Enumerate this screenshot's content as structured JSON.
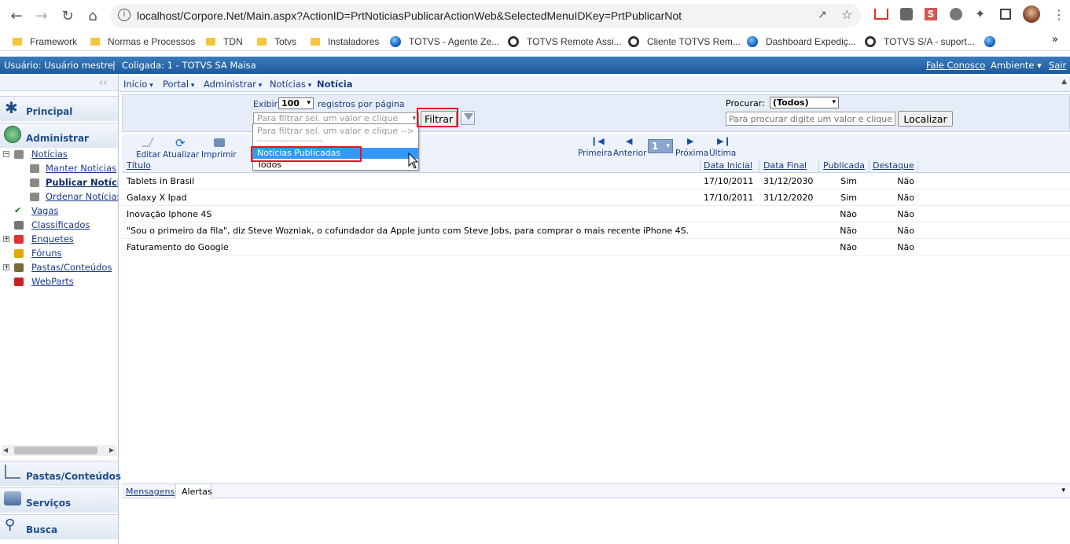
{
  "browser": {
    "url": "localhost/Corpore.Net/Main.aspx?ActionID=PrtNoticiasPublicarActionWeb&SelectedMenuIDKey=PrtPublicarNot",
    "bookmarks": [
      {
        "label": "Framework",
        "icon": "folder"
      },
      {
        "label": "Normas e Processos",
        "icon": "folder"
      },
      {
        "label": "TDN",
        "icon": "folder"
      },
      {
        "label": "Totvs",
        "icon": "folder"
      },
      {
        "label": "Instaladores",
        "icon": "folder"
      },
      {
        "label": "TOTVS - Agente Ze...",
        "icon": "globe"
      },
      {
        "label": "TOTVS Remote Assi...",
        "icon": "totvs"
      },
      {
        "label": "Cliente TOTVS Rem...",
        "icon": "totvs"
      },
      {
        "label": "Dashboard Expediç...",
        "icon": "globe"
      },
      {
        "label": "TOTVS S/A - suport...",
        "icon": "totvs"
      }
    ]
  },
  "topbar": {
    "user": "Usuário: Usuário mestre",
    "separator": "|",
    "coligada": "Coligada: 1 - TOTVS SA Maisa",
    "contact": "Fale Conosco",
    "ambiente": "Ambiente",
    "sair": "Sair"
  },
  "breadcrumb": {
    "items": [
      "Início",
      "Portal",
      "Administrar",
      "Notícias"
    ],
    "current": "Notícia"
  },
  "sidebar": {
    "collapse": "‹‹",
    "principal": "Principal",
    "administrar": "Administrar",
    "tree": [
      {
        "label": "Notícias",
        "level": 1
      },
      {
        "label": "Manter Notícias",
        "level": 2
      },
      {
        "label": "Publicar Notícia",
        "level": 2,
        "bold": true
      },
      {
        "label": "Ordenar Notícias",
        "level": 2
      },
      {
        "label": "Vagas",
        "level": 1
      },
      {
        "label": "Classificados",
        "level": 1
      },
      {
        "label": "Enquetes",
        "level": 1
      },
      {
        "label": "Fóruns",
        "level": 1
      },
      {
        "label": "Pastas/Conteúdos",
        "level": 1
      },
      {
        "label": "WebParts",
        "level": 1
      }
    ],
    "pastas": "Pastas/Conteúdos",
    "servicos": "Serviços",
    "busca": "Busca"
  },
  "filterpanel": {
    "exibir": "Exibir",
    "page_size": "100",
    "registros": "registros por página",
    "filter_placeholder": "Para filtrar sel. um valor e clique",
    "filtrar": "Filtrar",
    "procurar": "Procurar:",
    "procurar_value": "(Todos)",
    "search_placeholder": "Para procurar digite um valor e clique",
    "localizar": "Localizar"
  },
  "dropdown": {
    "options": [
      "Para filtrar sel. um valor e clique -->",
      "-----------------------",
      "Notícias Publicadas",
      "Todos"
    ],
    "highlighted": "Notícias Publicadas"
  },
  "toolbar": {
    "editar": "Editar",
    "atualizar": "Atualizar",
    "imprimir": "Imprimir",
    "primeira": "Primeira",
    "anterior": "Anterior",
    "page": "1",
    "proxima": "Próxima",
    "ultima": "Última"
  },
  "grid": {
    "columns": [
      "Título",
      "Data Inicial",
      "Data Final",
      "Publicada",
      "Destaque"
    ],
    "rows": [
      [
        "Tablets in Brasil",
        "17/10/2011",
        "31/12/2030",
        "Sim",
        "Não"
      ],
      [
        "Galaxy X Ipad",
        "17/10/2011",
        "31/12/2020",
        "Sim",
        "Não"
      ],
      [
        "Inovação Iphone 4S",
        "",
        "",
        "Não",
        "Não"
      ],
      [
        "\"Sou o primeiro da fila\", diz Steve Wozniak, o cofundador da Apple junto com Steve Jobs, para comprar o mais recente iPhone 4S.",
        "",
        "",
        "Não",
        "Não"
      ],
      [
        "Faturamento do Google",
        "",
        "",
        "Não",
        "Não"
      ]
    ]
  },
  "bottom": {
    "tabs": [
      "Mensagens",
      "Alertas"
    ]
  },
  "colors": {
    "topbar": "#1d5a9a",
    "link": "#1a3a8a",
    "highlight": "#3399ff",
    "annotation": "#e3141c"
  }
}
